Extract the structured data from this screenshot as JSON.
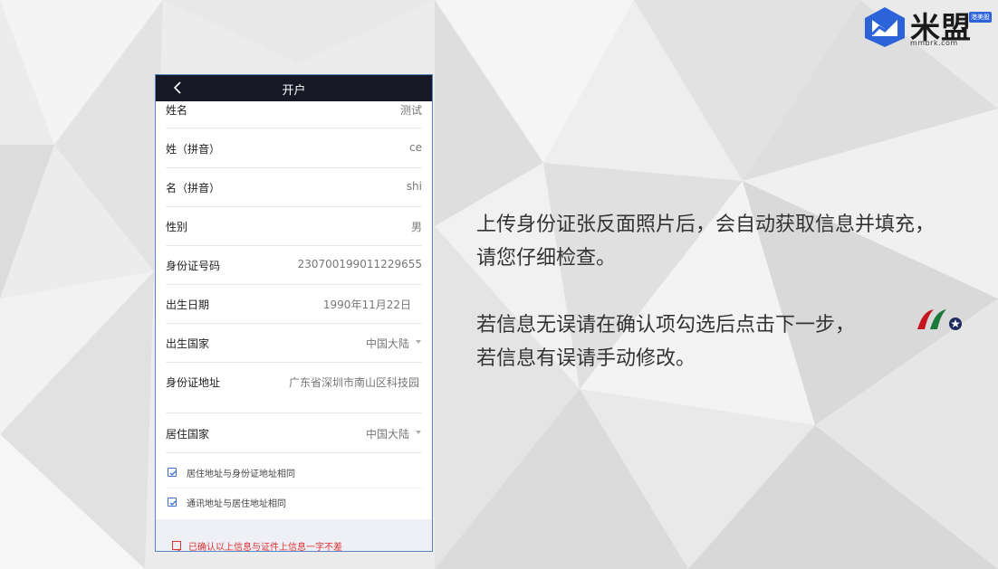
{
  "logo": {
    "name": "米盟",
    "badge": "港美股",
    "domain": "mmbrk.com"
  },
  "screen": {
    "title": "开户",
    "fields": [
      {
        "label": "姓名",
        "value": "测试"
      },
      {
        "label": "姓（拼音）",
        "value": "ce"
      },
      {
        "label": "名（拼音）",
        "value": "shi"
      },
      {
        "label": "性别",
        "value": "男"
      },
      {
        "label": "身份证号码",
        "value": "230700199011229655"
      },
      {
        "label": "出生日期",
        "value": "1990年11月22日"
      },
      {
        "label": "出生国家",
        "value": "中国大陆"
      },
      {
        "label": "身份证地址",
        "value": "广东省深圳市南山区科技园"
      },
      {
        "label": "居住国家",
        "value": "中国大陆"
      }
    ],
    "checkboxes": [
      {
        "label": "居住地址与身份证地址相同",
        "checked": true
      },
      {
        "label": "通讯地址与居住地址相同",
        "checked": true
      }
    ],
    "confirm": {
      "label": "已确认以上信息与证件上信息一字不差",
      "checked": true
    }
  },
  "description": {
    "para1_line1": "上传身份证张反面照片后，会自动获取信息并填充，",
    "para1_line2": "请您仔细检查。",
    "para2_line1": "若信息无误请在确认项勾选后点击下一步，",
    "para2_line2": "若信息有误请手动修改。"
  },
  "colors": {
    "accent": "#3a6fd0",
    "topbar": "#161826",
    "warning": "#dd3333"
  }
}
